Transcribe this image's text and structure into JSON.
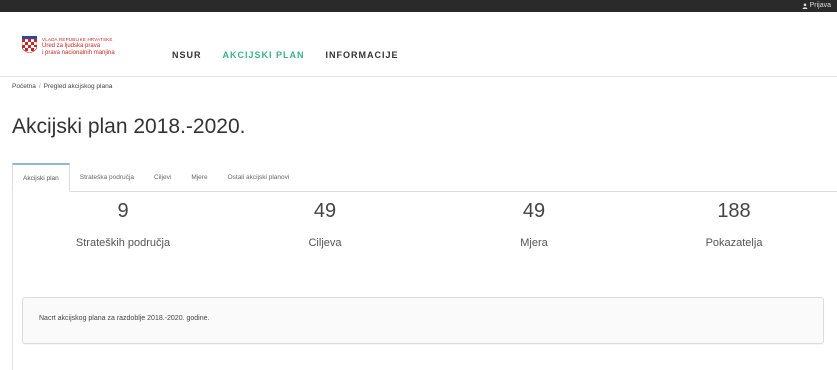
{
  "topbar": {
    "login_label": "Prijava"
  },
  "logo": {
    "line_small": "VLADA REPUBLIKE HRVATSKE",
    "line1": "Ured za ljudska prava",
    "line2": "i prava nacionalnih manjina"
  },
  "nav": {
    "items": [
      {
        "label": "NSUR"
      },
      {
        "label": "AKCIJSKI PLAN"
      },
      {
        "label": "INFORMACIJE"
      }
    ],
    "active_color": "#3bb38a"
  },
  "breadcrumb": {
    "home": "Početna",
    "separator": "/",
    "current": "Pregled akcijskog plana"
  },
  "page_title": "Akcijski plan 2018.-2020.",
  "tabs": [
    {
      "label": "Akcijski plan"
    },
    {
      "label": "Strateška područja"
    },
    {
      "label": "Ciljevi"
    },
    {
      "label": "Mjere"
    },
    {
      "label": "Ostali akcijski planovi"
    }
  ],
  "stats": [
    {
      "value": "9",
      "label": "Strateških područja"
    },
    {
      "value": "49",
      "label": "Ciljeva"
    },
    {
      "value": "49",
      "label": "Mjera"
    },
    {
      "value": "188",
      "label": "Pokazatelja"
    }
  ],
  "description": "Nacrt akcijskog plana za razdoblje 2018.-2020. godine."
}
